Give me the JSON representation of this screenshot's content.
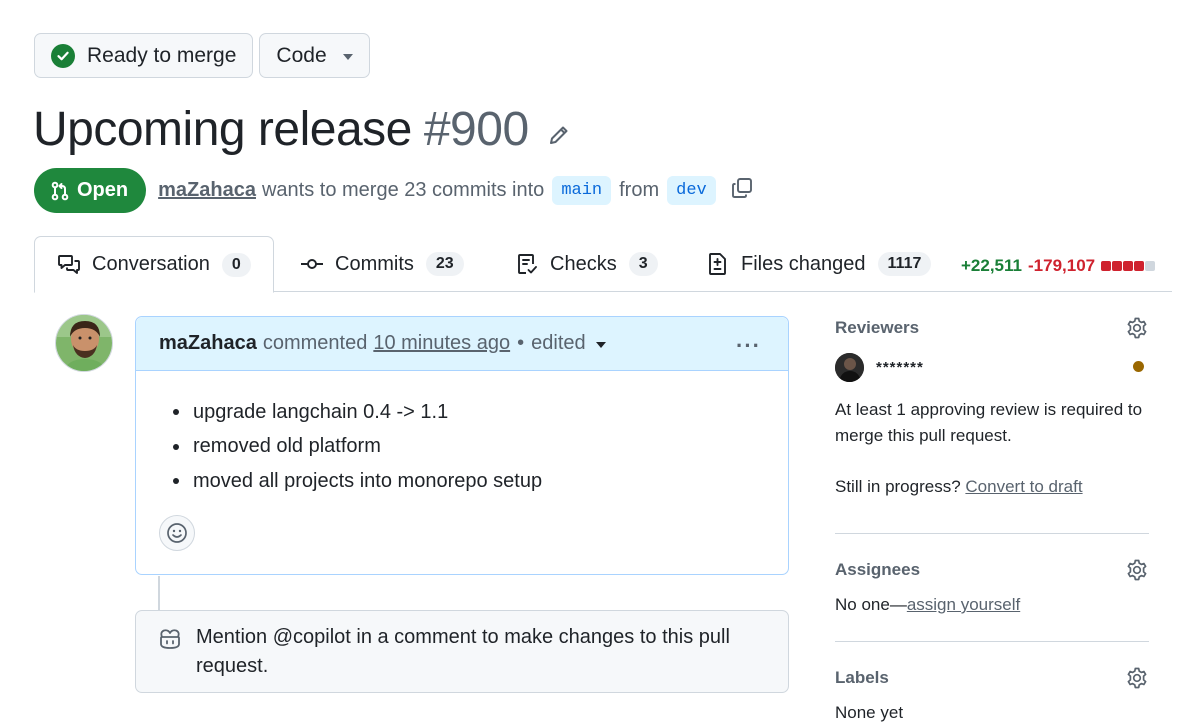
{
  "merge_status": {
    "label": "Ready to merge"
  },
  "code_button": {
    "label": "Code"
  },
  "pull_request": {
    "title": "Upcoming release",
    "number": "#900",
    "state": "Open",
    "author": "maZahaca",
    "summary": "wants to merge 23 commits into",
    "base_branch": "main",
    "from_word": "from",
    "head_branch": "dev"
  },
  "tabs": [
    {
      "label": "Conversation",
      "count": "0",
      "icon": "conversation-icon"
    },
    {
      "label": "Commits",
      "count": "23",
      "icon": "commit-icon"
    },
    {
      "label": "Checks",
      "count": "3",
      "icon": "checklist-icon"
    },
    {
      "label": "Files changed",
      "count": "1117",
      "icon": "file-diff-icon"
    }
  ],
  "diffstat": {
    "additions": "+22,511",
    "deletions": "-179,107",
    "blocks": [
      "red",
      "red",
      "red",
      "red",
      "gray"
    ],
    "colors": {
      "red": "#cf222e",
      "gray": "#d0d7de",
      "green": "#1a7f37"
    }
  },
  "comment": {
    "author": "maZahaca",
    "action": "commented",
    "time": "10 minutes ago",
    "separator": "•",
    "edited": "edited",
    "items": [
      "upgrade langchain 0.4 -> 1.1",
      "removed old platform",
      "moved all projects into monorepo setup"
    ],
    "more": "···"
  },
  "copilot_tip": {
    "text": "Mention @copilot in a comment to make changes to this pull request."
  },
  "sidebar": {
    "reviewers": {
      "title": "Reviewers",
      "reviewer_name": "*******",
      "status_color": "#9a6700",
      "requirement": "At least 1 approving review is required to merge this pull request.",
      "progress_prefix": "Still in progress?",
      "draft_link": "Convert to draft"
    },
    "assignees": {
      "title": "Assignees",
      "prefix": "No one—",
      "link": "assign yourself"
    },
    "labels": {
      "title": "Labels",
      "value": "None yet"
    }
  },
  "colors": {
    "open_green": "#1f883d",
    "link_blue": "#0969da",
    "comment_header_bg": "#ddf4ff"
  }
}
